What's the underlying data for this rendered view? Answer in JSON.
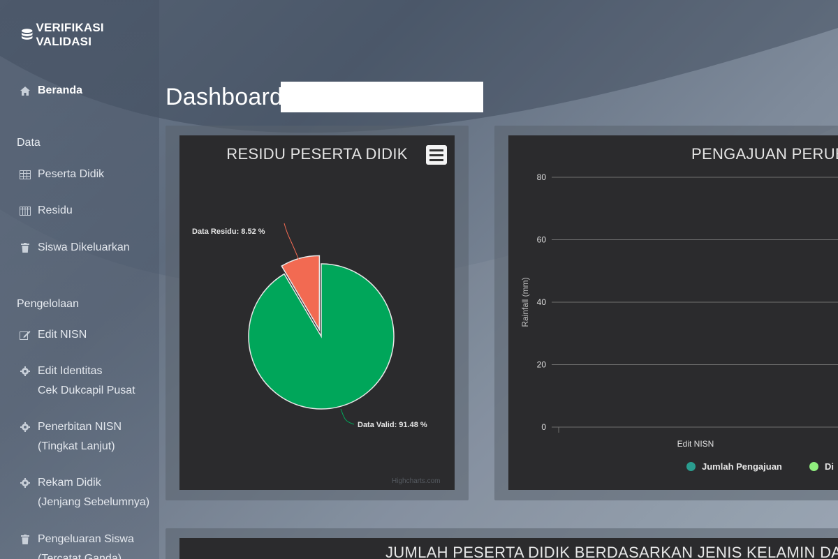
{
  "brand": {
    "title": "VERIFIKASI VALIDASI",
    "icon": "database-icon"
  },
  "sidebar": {
    "home": {
      "label": "Beranda",
      "icon": "home-icon"
    },
    "section_data": "Data",
    "data_items": [
      {
        "label": "Peserta Didik",
        "icon": "table-icon"
      },
      {
        "label": "Residu",
        "icon": "columns-icon"
      },
      {
        "label": "Siswa Dikeluarkan",
        "icon": "trash-icon"
      }
    ],
    "section_manage": "Pengelolaan",
    "manage_items": [
      {
        "line1": "Edit NISN",
        "line2": "",
        "icon": "edit-icon"
      },
      {
        "line1": "Edit Identitas",
        "line2": "Cek Dukcapil Pusat",
        "icon": "gear-icon"
      },
      {
        "line1": "Penerbitan NISN",
        "line2": "(Tingkat Lanjut)",
        "icon": "gear-icon"
      },
      {
        "line1": "Rekam Didik",
        "line2": "(Jenjang Sebelumnya)",
        "icon": "gear-icon"
      },
      {
        "line1": "Pengeluaran Siswa",
        "line2": "(Tercatat Ganda)",
        "icon": "trash-icon"
      }
    ]
  },
  "page": {
    "title": "Dashboard"
  },
  "pie_card": {
    "title": "RESIDU PESERTA DIDIK",
    "credits": "Highcharts.com",
    "menu_icon": "hamburger-menu-icon"
  },
  "bar_card": {
    "title": "PENGAJUAN PERUB",
    "legend": [
      {
        "name": "Jumlah Pengajuan",
        "color": "#2a9d8f"
      },
      {
        "name": "Di",
        "color": "#90ee7e"
      }
    ]
  },
  "bottom_card": {
    "title": "JUMLAH PESERTA DIDIK BERDASARKAN JENIS KELAMIN DAN"
  },
  "colors": {
    "valid": "#00a65a",
    "residu": "#f26a52"
  },
  "chart_data": [
    {
      "type": "pie",
      "title": "RESIDU PESERTA DIDIK",
      "slices": [
        {
          "name": "Data Valid",
          "value": 91.48,
          "label": "Data Valid: 91.48 %",
          "color": "#00a65a"
        },
        {
          "name": "Data Residu",
          "value": 8.52,
          "label": "Data Residu: 8.52 %",
          "color": "#f26a52"
        }
      ]
    },
    {
      "type": "bar",
      "title": "PENGAJUAN PERUB",
      "categories": [
        "Edit NISN"
      ],
      "ylabel": "Rainfall (mm)",
      "ylim": [
        0,
        80
      ],
      "yticks": [
        0,
        20,
        40,
        60,
        80
      ],
      "grid": true,
      "legend": "bottom",
      "series": [
        {
          "name": "Jumlah Pengajuan",
          "values": [
            0
          ]
        },
        {
          "name": "Di",
          "values": [
            0
          ]
        }
      ]
    }
  ]
}
